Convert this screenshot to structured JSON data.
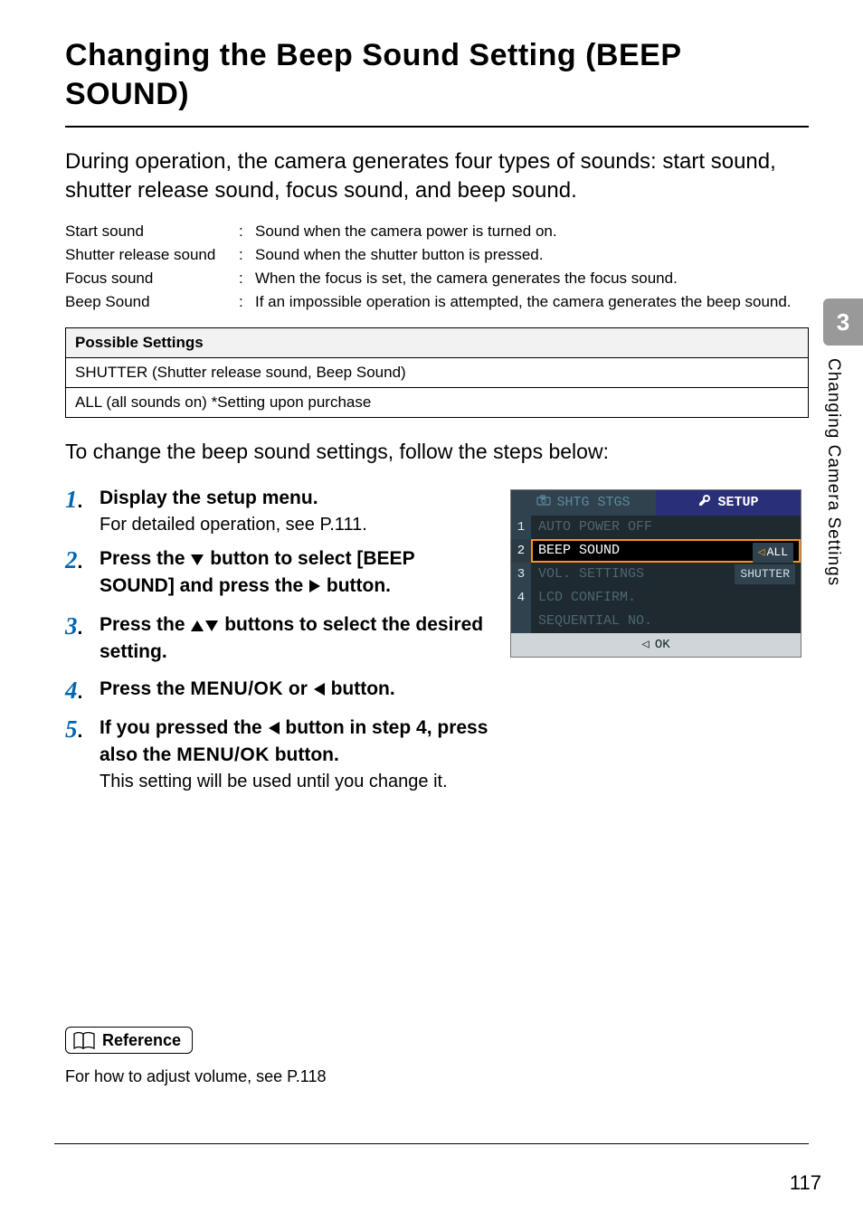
{
  "page_number": "117",
  "chapter_tab": {
    "number": "3",
    "label": "Changing Camera Settings"
  },
  "heading": "Changing the Beep Sound Setting (BEEP SOUND)",
  "intro": "During operation, the camera generates four types of sounds: start sound, shutter release sound, focus sound, and beep sound.",
  "definitions": [
    {
      "name": "Start sound",
      "value": "Sound when the camera power is turned on."
    },
    {
      "name": "Shutter release sound",
      "value": "Sound when the shutter button is pressed."
    },
    {
      "name": "Focus sound",
      "value": "When the focus is set, the camera generates the focus sound."
    },
    {
      "name": "Beep Sound",
      "value": "If an impossible operation is attempted, the camera generates the beep sound."
    }
  ],
  "settings_table": {
    "header": "Possible Settings",
    "rows": [
      "SHUTTER (Shutter release sound, Beep Sound)",
      "ALL (all sounds on) *Setting upon purchase"
    ]
  },
  "lead2": "To change the beep sound settings, follow the steps below:",
  "steps": {
    "s1": {
      "title": "Display the setup menu.",
      "sub": "For detailed operation, see P.111."
    },
    "s2": {
      "title_before": "Press the ",
      "title_mid": " button to select [BEEP SOUND] and press the ",
      "title_after": " button."
    },
    "s3": {
      "title_before": "Press the ",
      "title_after": " buttons to select the desired setting."
    },
    "s4": {
      "title_before": "Press the ",
      "menu_label": "MENU/OK",
      "title_mid": " or ",
      "title_after": " button."
    },
    "s5": {
      "title_before": "If you pressed the ",
      "title_mid": " button in step 4, press also the ",
      "menu_label": "MENU/OK",
      "title_after": " button.",
      "sub": "This setting will be used until you change it."
    }
  },
  "lcd": {
    "tab_inactive": "SHTG STGS",
    "tab_active": "SETUP",
    "rows": [
      {
        "n": "1",
        "label": "AUTO POWER OFF",
        "dim": true
      },
      {
        "n": "2",
        "label": "BEEP SOUND",
        "selected": true,
        "opt": "ALL"
      },
      {
        "n": "3",
        "label": "VOL. SETTINGS",
        "dim": true,
        "opt": "SHUTTER"
      },
      {
        "n": "4",
        "label": "LCD CONFIRM.",
        "dim": true
      },
      {
        "n": "",
        "label": "SEQUENTIAL NO.",
        "dim": true
      }
    ],
    "footer": "OK"
  },
  "reference": {
    "label": "Reference",
    "text": "For how to adjust volume, see P.118"
  }
}
